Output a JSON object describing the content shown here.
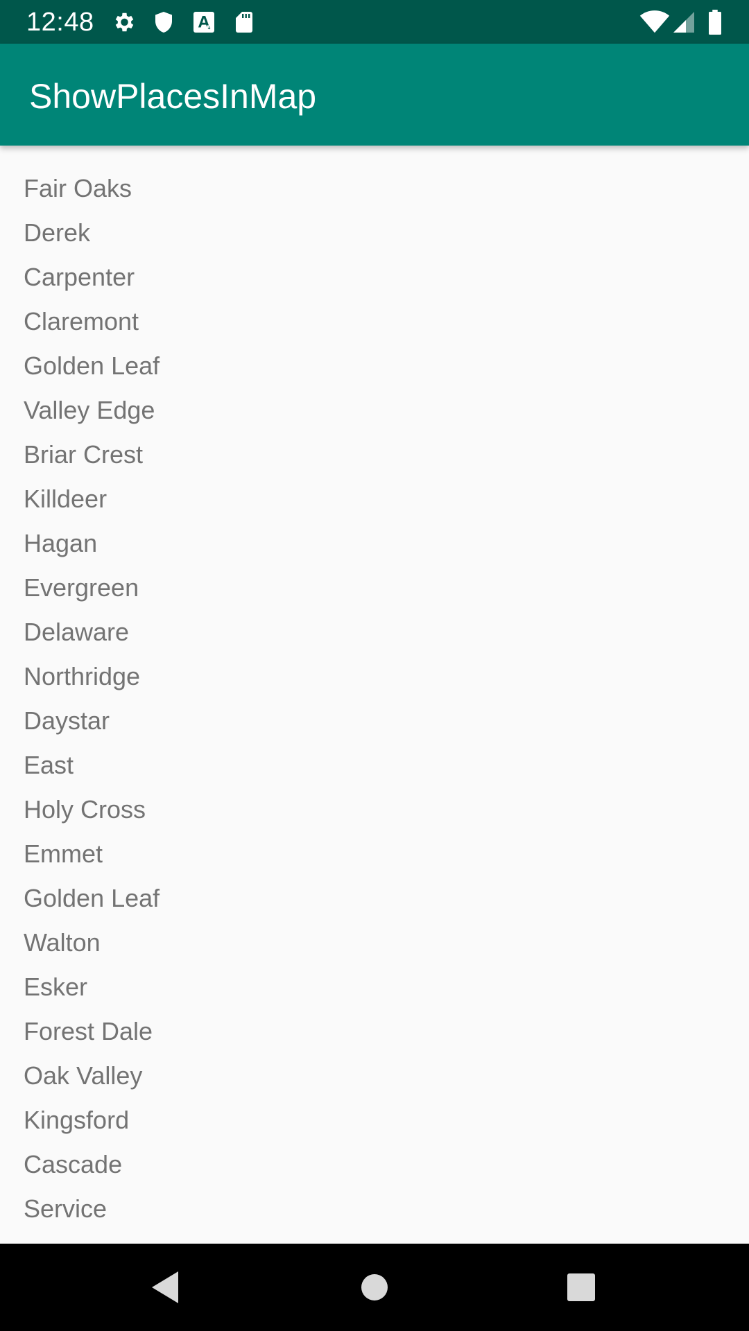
{
  "status_bar": {
    "time": "12:48",
    "left_icons": [
      "gear-icon",
      "shield-icon",
      "font-download-icon",
      "sd-card-icon"
    ],
    "right_icons": [
      "wifi-icon",
      "signal-icon",
      "battery-icon"
    ]
  },
  "app_bar": {
    "title": "ShowPlacesInMap",
    "color": "#008577"
  },
  "places": [
    "Fair Oaks",
    "Derek",
    "Carpenter",
    "Claremont",
    "Golden Leaf",
    "Valley Edge",
    "Briar Crest",
    "Killdeer",
    "Hagan",
    "Evergreen",
    "Delaware",
    "Northridge",
    "Daystar",
    "East",
    "Holy Cross",
    "Emmet",
    "Golden Leaf",
    "Walton",
    "Esker",
    "Forest Dale",
    "Oak Valley",
    "Kingsford",
    "Cascade",
    "Service"
  ],
  "nav_bar": {
    "buttons": [
      "back-icon",
      "home-icon",
      "recents-icon"
    ]
  }
}
